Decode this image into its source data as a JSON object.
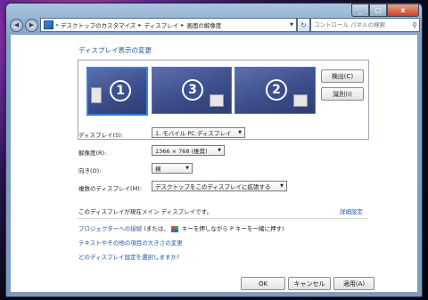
{
  "window": {
    "close_glyph": "x",
    "min_glyph": "_",
    "max_glyph": "□"
  },
  "nav": {
    "back_glyph": "◀",
    "forward_glyph": "▶",
    "crumb_prefix": "«",
    "breadcrumbs": [
      "デスクトップのカスタマイズ",
      "ディスプレイ",
      "画面の解像度"
    ],
    "crumb_sep": "▸",
    "dropdown_glyph": "▼",
    "refresh_glyph": "↻",
    "search_placeholder": "コントロール パネルの検索",
    "search_glyph": "⚲"
  },
  "page": {
    "title": "ディスプレイ表示の変更"
  },
  "monitors": [
    {
      "number": "1",
      "selected": true
    },
    {
      "number": "3",
      "selected": false
    },
    {
      "number": "2",
      "selected": false
    }
  ],
  "buttons": {
    "detect": "検出(C)",
    "identify": "識別(I)",
    "ok": "OK",
    "cancel": "キャンセル",
    "apply": "適用(A)"
  },
  "settings": {
    "display_label": "ディスプレイ(S):",
    "display_value": "1. モバイル PC ディスプレイ",
    "resolution_label": "解像度(R):",
    "resolution_value": "1366 × 768 (推奨)",
    "orientation_label": "向き(O):",
    "orientation_value": "横",
    "multi_label": "複数のディスプレイ(M):",
    "multi_value": "デスクトップをこのディスプレイに拡張する",
    "dropdown_glyph": "▼"
  },
  "info": {
    "main_display_text": "このディスプレイが現在メイン ディスプレイです。",
    "advanced_link": "詳細設定"
  },
  "links": {
    "projector_link": "プロジェクターへの接続",
    "projector_rest": " (または、",
    "projector_rest2": " キーを押しながら P キーを一緒に押す)",
    "text_size_link": "テキストやその他の項目の大きさの変更",
    "which_settings_link": "どのディスプレイ設定を選択しますか?"
  }
}
